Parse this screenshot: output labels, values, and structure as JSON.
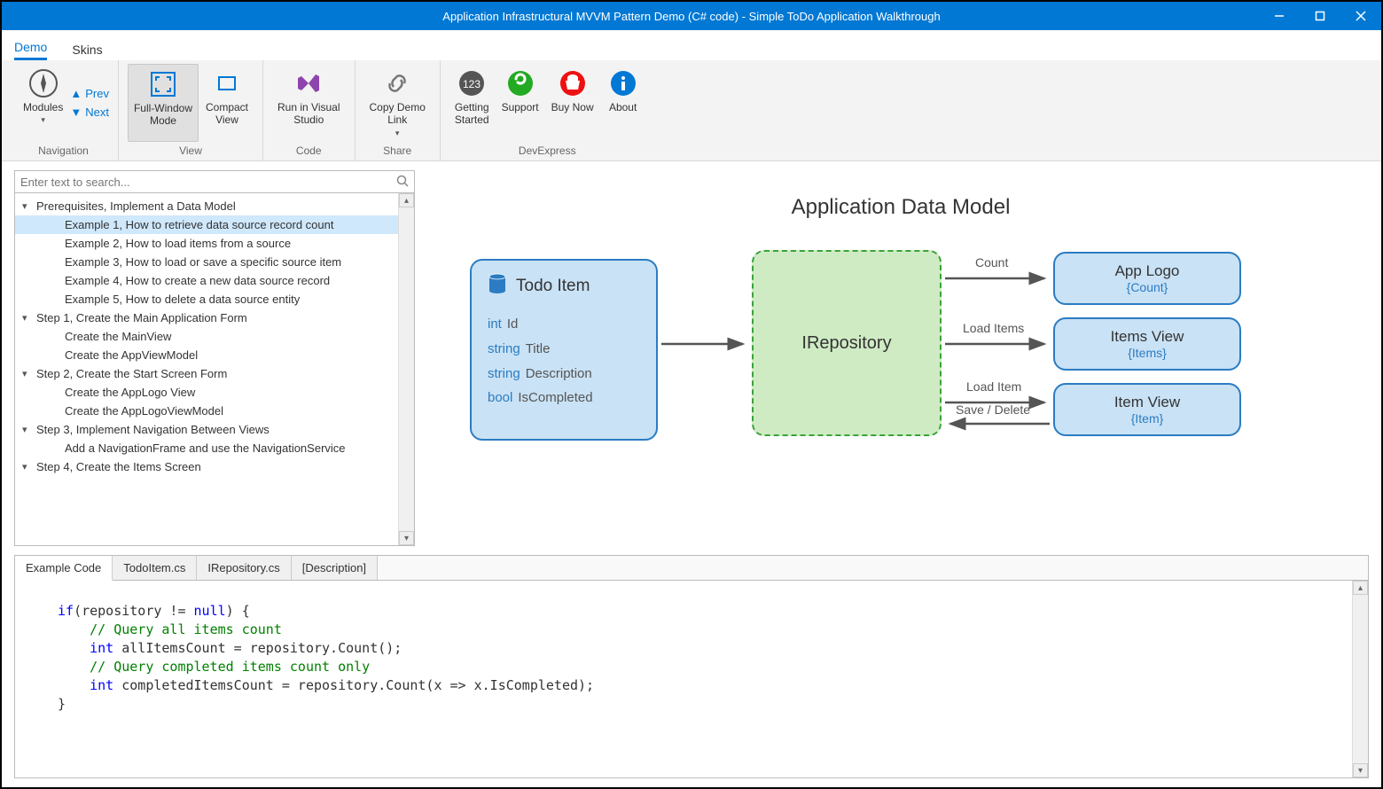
{
  "window": {
    "title": "Application Infrastructural MVVM Pattern Demo (C# code) - Simple ToDo Application Walkthrough"
  },
  "menubar": {
    "tabs": [
      "Demo",
      "Skins"
    ],
    "active": 0
  },
  "ribbon": {
    "groups": [
      {
        "label": "Navigation",
        "items": [
          {
            "kind": "modules",
            "label": "Modules"
          },
          {
            "kind": "nav-prev",
            "label": "Prev"
          },
          {
            "kind": "nav-next",
            "label": "Next"
          }
        ]
      },
      {
        "label": "View",
        "items": [
          {
            "kind": "fullwindow",
            "label": "Full-Window\nMode",
            "selected": true
          },
          {
            "kind": "compact",
            "label": "Compact\nView"
          }
        ]
      },
      {
        "label": "Code",
        "items": [
          {
            "kind": "runvs",
            "label": "Run in Visual\nStudio"
          }
        ]
      },
      {
        "label": "Share",
        "items": [
          {
            "kind": "copydemo",
            "label": "Copy Demo\nLink"
          }
        ]
      },
      {
        "label": "DevExpress",
        "items": [
          {
            "kind": "getting",
            "label": "Getting\nStarted"
          },
          {
            "kind": "support",
            "label": "Support"
          },
          {
            "kind": "buynow",
            "label": "Buy Now"
          },
          {
            "kind": "about",
            "label": "About"
          }
        ]
      }
    ]
  },
  "search": {
    "placeholder": "Enter text to search..."
  },
  "tree": [
    {
      "type": "group",
      "label": "Prerequisites, Implement a Data Model"
    },
    {
      "type": "child",
      "label": "Example 1, How to retrieve data source record count",
      "selected": true
    },
    {
      "type": "child",
      "label": "Example 2, How to load items from a source"
    },
    {
      "type": "child",
      "label": "Example 3, How to load or save a specific source item"
    },
    {
      "type": "child",
      "label": "Example 4, How to create a new data source record"
    },
    {
      "type": "child",
      "label": "Example 5, How to delete a data source entity"
    },
    {
      "type": "group",
      "label": "Step 1, Create the Main Application Form"
    },
    {
      "type": "child",
      "label": "Create the MainView"
    },
    {
      "type": "child",
      "label": "Create the AppViewModel"
    },
    {
      "type": "group",
      "label": "Step 2, Create the Start Screen Form"
    },
    {
      "type": "child",
      "label": "Create the AppLogo View"
    },
    {
      "type": "child",
      "label": "Create the AppLogoViewModel"
    },
    {
      "type": "group",
      "label": "Step 3, Implement Navigation Between Views"
    },
    {
      "type": "child",
      "label": "Add a NavigationFrame and use the NavigationService"
    },
    {
      "type": "group",
      "label": "Step 4, Create the Items Screen"
    }
  ],
  "diagram": {
    "title": "Application Data Model",
    "todo": {
      "title": "Todo Item",
      "fields": [
        {
          "type": "int",
          "name": "Id"
        },
        {
          "type": "string",
          "name": "Title"
        },
        {
          "type": "string",
          "name": "Description"
        },
        {
          "type": "bool",
          "name": "IsCompleted"
        }
      ]
    },
    "repo": {
      "title": "IRepository"
    },
    "views": [
      {
        "title": "App Logo",
        "bind": "{Count}"
      },
      {
        "title": "Items View",
        "bind": "{Items}"
      },
      {
        "title": "Item View",
        "bind": "{Item}"
      }
    ],
    "labels": {
      "count": "Count",
      "loadItems": "Load Items",
      "loadItem": "Load Item",
      "saveDelete": "Save / Delete"
    }
  },
  "codeTabs": [
    "Example Code",
    "TodoItem.cs",
    "IRepository.cs",
    "[Description]"
  ],
  "code": {
    "l1a": "if",
    "l1b": "(repository != ",
    "l1c": "null",
    "l1d": ") {",
    "l2": "// Query all items count",
    "l3a": "int",
    "l3b": " allItemsCount = repository.Count();",
    "l4": "// Query completed items count only",
    "l5a": "int",
    "l5b": " completedItemsCount = repository.Count(x => x.IsCompleted);",
    "l6": "}"
  }
}
